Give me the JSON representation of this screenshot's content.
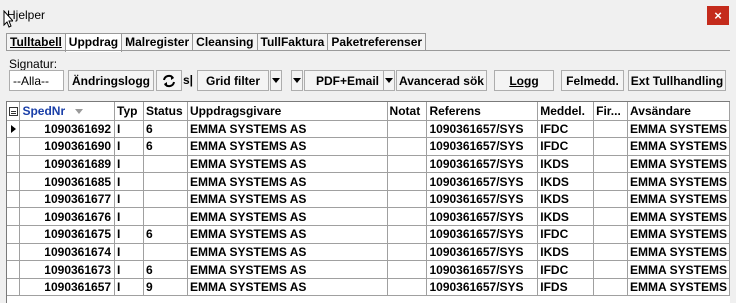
{
  "window": {
    "title": "Hjelper",
    "close_glyph": "×"
  },
  "tabs": [
    {
      "label": "Tulltabell",
      "active": false
    },
    {
      "label": "Uppdrag",
      "active": true
    },
    {
      "label": "Malregister",
      "active": false
    },
    {
      "label": "Cleansing",
      "active": false
    },
    {
      "label": "TullFaktura",
      "active": false
    },
    {
      "label": "Paketreferenser",
      "active": false
    }
  ],
  "toolbar": {
    "signatur_label": "Signatur:",
    "signatur_value": "--Alla--",
    "andringslogg": "Ändringslogg",
    "s_label": "s|",
    "grid_filter": "Grid filter",
    "pdf_email": "PDF+Email",
    "avancerad_sok": "Avancerad sök",
    "logg": "Logg",
    "felmedd": "Felmedd.",
    "ext_tullhandling": "Ext Tullhandling"
  },
  "grid": {
    "columns": [
      "SpedNr",
      "Typ",
      "Status",
      "Uppdragsgivare",
      "Notat",
      "Referens",
      "Meddel.",
      "Fir...",
      "Avsändare"
    ],
    "rows": [
      [
        "1090361692",
        "I",
        "6",
        "EMMA SYSTEMS AS",
        "",
        "1090361657/SYS",
        "IFDC",
        "",
        "EMMA SYSTEMS"
      ],
      [
        "1090361690",
        "I",
        "6",
        "EMMA SYSTEMS AS",
        "",
        "1090361657/SYS",
        "IFDC",
        "",
        "EMMA SYSTEMS"
      ],
      [
        "1090361689",
        "I",
        "",
        "EMMA SYSTEMS AS",
        "",
        "1090361657/SYS",
        "IKDS",
        "",
        "EMMA SYSTEMS"
      ],
      [
        "1090361685",
        "I",
        "",
        "EMMA SYSTEMS AS",
        "",
        "1090361657/SYS",
        "IKDS",
        "",
        "EMMA SYSTEMS"
      ],
      [
        "1090361677",
        "I",
        "",
        "EMMA SYSTEMS AS",
        "",
        "1090361657/SYS",
        "IKDS",
        "",
        "EMMA SYSTEMS"
      ],
      [
        "1090361676",
        "I",
        "",
        "EMMA SYSTEMS AS",
        "",
        "1090361657/SYS",
        "IKDS",
        "",
        "EMMA SYSTEMS"
      ],
      [
        "1090361675",
        "I",
        "6",
        "EMMA SYSTEMS AS",
        "",
        "1090361657/SYS",
        "IFDC",
        "",
        "EMMA SYSTEMS"
      ],
      [
        "1090361674",
        "I",
        "",
        "EMMA SYSTEMS AS",
        "",
        "1090361657/SYS",
        "IKDS",
        "",
        "EMMA SYSTEMS"
      ],
      [
        "1090361673",
        "I",
        "6",
        "EMMA SYSTEMS AS",
        "",
        "1090361657/SYS",
        "IFDC",
        "",
        "EMMA SYSTEMS"
      ],
      [
        "1090361657",
        "I",
        "9",
        "EMMA SYSTEMS AS",
        "",
        "1090361657/SYS",
        "IFDS",
        "",
        "EMMA SYSTEMS"
      ]
    ],
    "selected_row": 0
  },
  "colors": {
    "close_button": "#c42b1c",
    "sorted_header": "#1a3fa8"
  }
}
